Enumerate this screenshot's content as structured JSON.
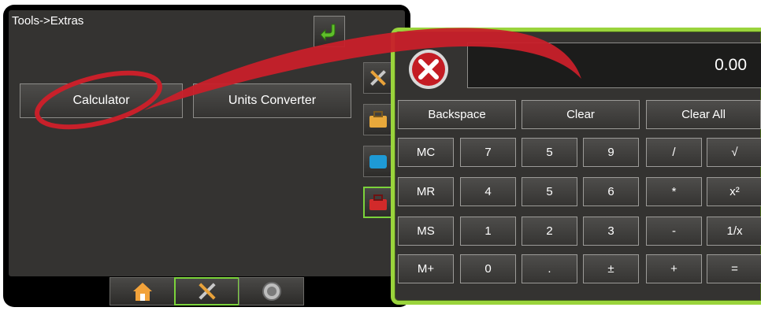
{
  "screen": {
    "breadcrumb": "Tools->Extras",
    "buttons": {
      "calculator": "Calculator",
      "units_converter": "Units Converter"
    }
  },
  "calculator": {
    "display_value": "0.00",
    "top_row": [
      "Backspace",
      "Clear",
      "Clear All"
    ],
    "keys": [
      [
        "MC",
        "7",
        "5",
        "9",
        "/",
        "√"
      ],
      [
        "MR",
        "4",
        "5",
        "6",
        "*",
        "x²"
      ],
      [
        "MS",
        "1",
        "2",
        "3",
        "-",
        "1/x"
      ],
      [
        "M+",
        "0",
        ".",
        "±",
        "+",
        "="
      ]
    ]
  },
  "colors": {
    "accent": "#9ad43c",
    "callout": "#c8202a",
    "panel": "#343331"
  },
  "icons": [
    "back-arrow-icon",
    "tools-icon",
    "toolbox-icon",
    "folder-icon",
    "red-toolbox-icon",
    "home-icon",
    "wrench-screwdriver-icon",
    "gauge-icon",
    "close-icon"
  ]
}
